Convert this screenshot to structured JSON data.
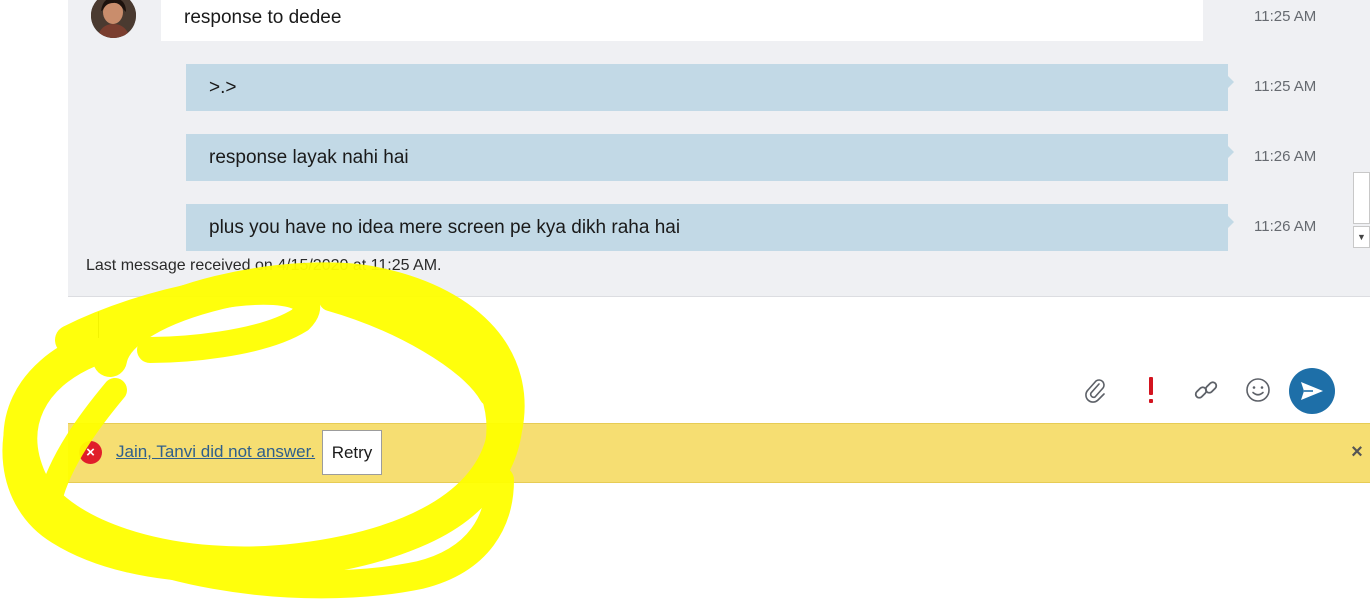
{
  "conversation": {
    "messages": [
      {
        "text": "response to dedee",
        "time": "11:25 AM",
        "direction": "incoming"
      },
      {
        "text": ">.>",
        "time": "11:25 AM",
        "direction": "outgoing"
      },
      {
        "text": "response layak nahi hai",
        "time": "11:26 AM",
        "direction": "outgoing"
      },
      {
        "text": "plus you have no idea mere screen pe kya dikh raha hai",
        "time": "11:26 AM",
        "direction": "outgoing"
      }
    ],
    "last_received": "Last message received on 4/15/2020 at 11:25 AM."
  },
  "compose": {
    "value": "",
    "tools": [
      "paperclip-icon",
      "exclamation-icon",
      "link-icon",
      "smiley-icon",
      "send-icon"
    ]
  },
  "notification": {
    "message": "Jain, Tanvi did not answer.",
    "retry_label": "Retry",
    "close_label": "×",
    "error_glyph": "×"
  },
  "colors": {
    "accent": "#1e6fa8",
    "notice_background": "#f6de72",
    "outgoing_bubble": "#c2d9e6",
    "error": "#e01e2a",
    "highlight": "#ffff00"
  }
}
